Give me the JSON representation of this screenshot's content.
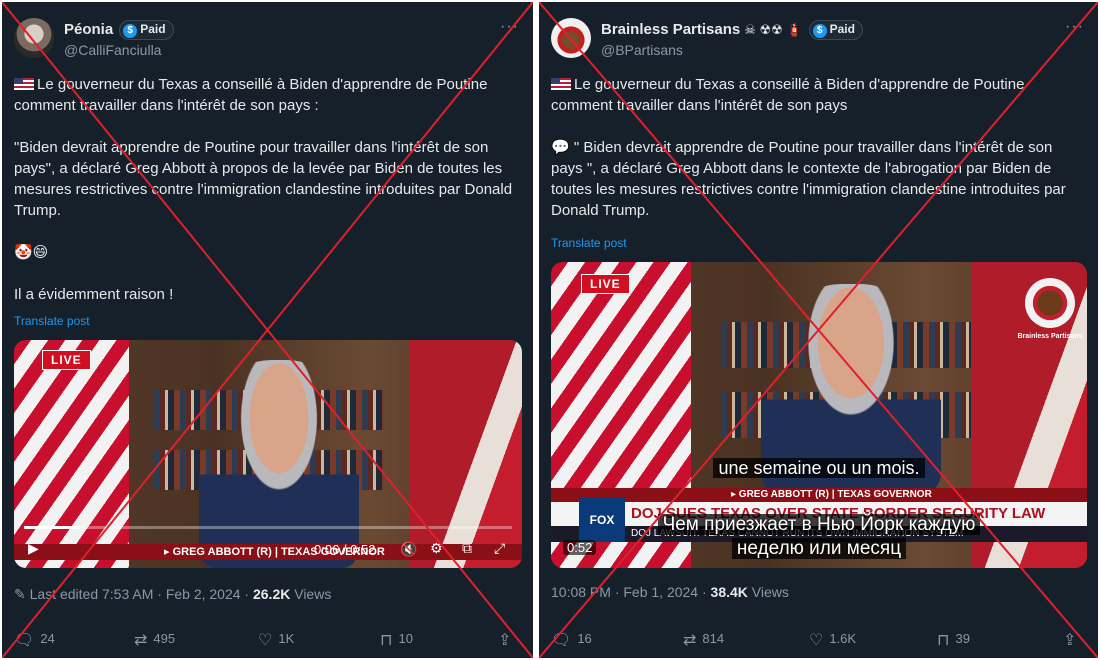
{
  "tweets": [
    {
      "name": "Péonia",
      "name_emoji": "",
      "paid_label": "Paid",
      "handle": "@CalliFanciulla",
      "text1": "Le gouverneur du Texas a conseillé à Biden d'apprendre de Poutine comment travailler dans l'intérêt de son pays :",
      "text2": " \"Biden devrait apprendre de Poutine pour travailler dans l'intérêt de son pays\", a déclaré Greg Abbott à propos de la levée par Biden de toutes les mesures restrictives contre l'immigration clandestine introduites par Donald Trump.",
      "emojis": "🤡😄",
      "text3": "Il a évidemment raison !",
      "translate": "Translate post",
      "video": {
        "live": "LIVE",
        "lower_third": "▸ GREG ABBOTT (R) | TEXAS GOVERNOR",
        "time": "0:06 / 0:52",
        "progress": 0.115
      },
      "meta_prefix": "Last edited 7:53 AM · Feb 2, 2024 · ",
      "views_count": "26.2K",
      "views_label": " Views",
      "actions": {
        "replies": "24",
        "reposts": "495",
        "likes": "1K",
        "bookmarks": "10"
      }
    },
    {
      "name": "Brainless Partisans",
      "name_emoji": "☠ ☢☢ 🧯",
      "paid_label": "Paid",
      "handle": "@BPartisans",
      "text1": "Le gouverneur du Texas a conseillé à Biden d'apprendre de Poutine comment travailler dans l'intérêt de son pays",
      "text2": " \" Biden devrait apprendre de Poutine pour travailler dans l'intérêt de son pays \", a déclaré Greg Abbott dans le contexte de l'abrogation par Biden de toutes les mesures restrictives contre l'immigration clandestine introduites par Donald Trump.",
      "translate": "Translate post",
      "video": {
        "live": "LIVE",
        "lower_third": "▸ GREG ABBOTT (R) | TEXAS GOVERNOR",
        "headline": "DOJ SUES TEXAS OVER STATE BORDER SECURITY LAW",
        "ticker": "DOJ LAWSUIT: TEXAS CANNOT RUN ITS OWN IMMIGRATION SYSTEM",
        "watermark": "Brainless Partisans",
        "sub_fr": "une semaine ou un mois.",
        "sub_ru1": "Чем приезжает в Нью Йорк каждую",
        "sub_ru2": "неделю или месяц",
        "time": "0:52"
      },
      "meta_prefix": "10:08 PM · Feb 1, 2024 · ",
      "views_count": "38.4K",
      "views_label": " Views",
      "actions": {
        "replies": "16",
        "reposts": "814",
        "likes": "1.6K",
        "bookmarks": "39"
      }
    }
  ],
  "icons": {
    "more": "more-icon",
    "reply": "reply-icon",
    "repost": "repost-icon",
    "like": "heart-icon",
    "bookmark": "bookmark-icon",
    "share": "share-icon"
  },
  "colors": {
    "background": "#15202b",
    "link": "#1d9bf0",
    "cross": "#e0202a",
    "text": "#e7e9ea",
    "muted": "#8b98a5"
  }
}
